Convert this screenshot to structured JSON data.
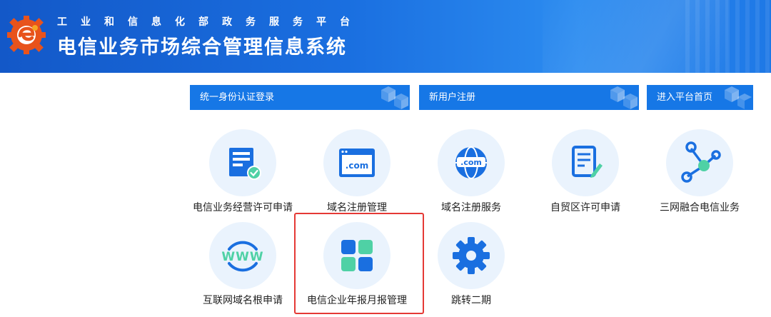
{
  "header": {
    "subtitle": "工业和信息化部政务服务平台",
    "title": "电信业务市场综合管理信息系统"
  },
  "nav": [
    {
      "label": "统一身份认证登录"
    },
    {
      "label": "新用户注册"
    },
    {
      "label": "进入平台首页"
    }
  ],
  "tiles": [
    {
      "label": "电信业务经营许可申请",
      "icon": "license-document-check-icon"
    },
    {
      "label": "域名注册管理",
      "icon": "dotcom-window-icon"
    },
    {
      "label": "域名注册服务",
      "icon": "dotcom-globe-icon"
    },
    {
      "label": "自贸区许可申请",
      "icon": "document-edit-icon"
    },
    {
      "label": "三网融合电信业务",
      "icon": "network-nodes-icon"
    },
    {
      "label": "互联网域名根申请",
      "icon": "www-icon"
    },
    {
      "label": "电信企业年报月报管理",
      "icon": "app-grid-icon"
    },
    {
      "label": "跳转二期",
      "icon": "gear-icon"
    }
  ],
  "colors": {
    "header_blue": "#1a6fe0",
    "nav_blue": "#1677e6",
    "icon_blue": "#1a6fe0",
    "icon_green": "#4fd1a5",
    "highlight_red": "#e53935"
  }
}
